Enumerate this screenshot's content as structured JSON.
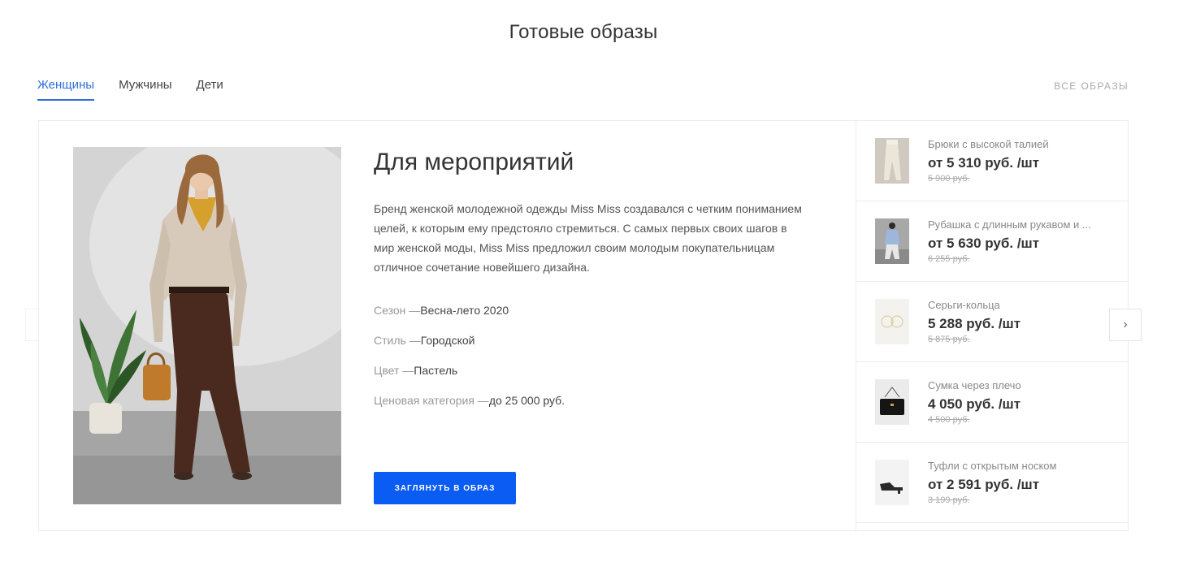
{
  "section": {
    "title": "Готовые образы",
    "all_link": "ВСЕ ОБРАЗЫ"
  },
  "tabs": [
    {
      "label": "Женщины",
      "active": true
    },
    {
      "label": "Мужчины",
      "active": false
    },
    {
      "label": "Дети",
      "active": false
    }
  ],
  "look": {
    "title": "Для мероприятий",
    "description": "Бренд женской молодежной одежды Miss Miss создавался с четким пониманием целей, к которым ему предстояло стремиться. С самых первых своих шагов в мир женской моды, Miss Miss предложил своим молодым покупательницам отличное сочетание новейшего дизайна.",
    "attributes": [
      {
        "label": "Сезон —",
        "value": "Весна-лето 2020"
      },
      {
        "label": "Стиль —",
        "value": "Городской"
      },
      {
        "label": "Цвет —",
        "value": "Пастель"
      },
      {
        "label": "Ценовая категория —",
        "value": "до 25 000 руб."
      }
    ],
    "cta": "ЗАГЛЯНУТЬ В ОБРАЗ"
  },
  "products": [
    {
      "name": "Брюки с высокой талией",
      "price": "от 5 310 руб. /шт",
      "old_price": "5 900 руб."
    },
    {
      "name": "Рубашка с длинным рукавом и ...",
      "price": "от 5 630 руб. /шт",
      "old_price": "6 255 руб."
    },
    {
      "name": "Серьги-кольца",
      "price": "5 288 руб. /шт",
      "old_price": "5 875 руб."
    },
    {
      "name": "Сумка через плечо",
      "price": "4 050 руб. /шт",
      "old_price": "4 500 руб."
    },
    {
      "name": "Туфли с открытым носком",
      "price": "от 2 591 руб. /шт",
      "old_price": "3 199 руб."
    }
  ],
  "icons": {
    "prev": "chevron-left-icon",
    "next": "chevron-right-icon"
  },
  "colors": {
    "accent": "#2f6fd8",
    "button": "#0b5cf2"
  }
}
